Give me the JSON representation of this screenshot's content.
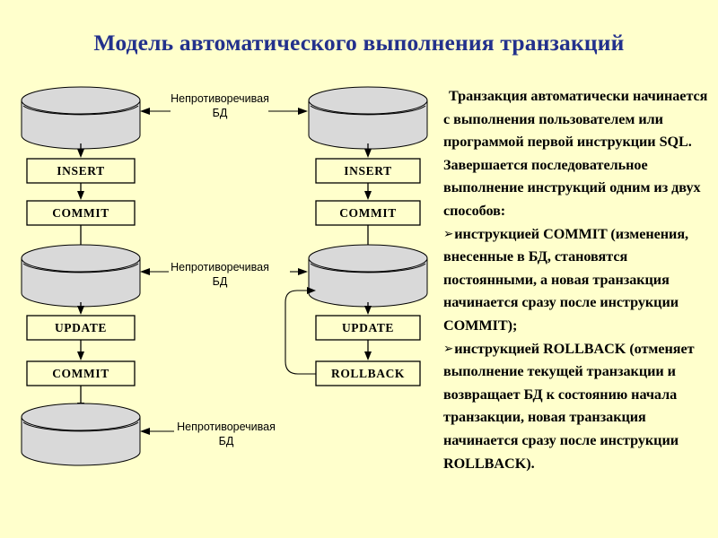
{
  "slide": {
    "title": "Модель автоматического выполнения транзакций",
    "background_color": "#ffffcc",
    "title_color": "#23318c",
    "cylinder_fill": "#d9d9d9"
  },
  "diagram": {
    "left_column": {
      "name": "commit-flow",
      "steps": [
        {
          "type": "database",
          "label": ""
        },
        {
          "type": "statement",
          "label": "INSERT"
        },
        {
          "type": "statement",
          "label": "COMMIT"
        },
        {
          "type": "database",
          "label": ""
        },
        {
          "type": "statement",
          "label": "UPDATE"
        },
        {
          "type": "statement",
          "label": "COMMIT"
        },
        {
          "type": "database",
          "label": ""
        }
      ]
    },
    "right_column": {
      "name": "rollback-flow",
      "steps": [
        {
          "type": "database",
          "label": ""
        },
        {
          "type": "statement",
          "label": "INSERT"
        },
        {
          "type": "statement",
          "label": "COMMIT"
        },
        {
          "type": "database",
          "label": ""
        },
        {
          "type": "statement",
          "label": "UPDATE"
        },
        {
          "type": "statement",
          "label": "ROLLBACK"
        }
      ]
    },
    "connector_labels": [
      {
        "line1": "Непротиворечивая",
        "line2": "БД"
      },
      {
        "line1": "Непротиворечивая",
        "line2": "БД"
      },
      {
        "line1": "Непротиворечивая",
        "line2": "БД"
      }
    ]
  },
  "panel": {
    "intro": "Транзакция автоматически начинается с выполнения пользователем или программой первой инструкции SQL. Завершается последовательное выполнение инструкций одним из двух способов:",
    "bullet_glyph": "➢",
    "bullets": [
      {
        "lead": "инструкцией ",
        "keyword": "COMMIT",
        "rest": " (изменения, внесенные в БД, становятся постоянными, а новая транзакция начинается сразу после инструкции COMMIT);"
      },
      {
        "lead": "инструкцией ",
        "keyword": "ROLLBACK",
        "rest": " (отменяет выполнение текущей транзакции и возвращает БД к состоянию начала транзакции, новая транзакция начинается сразу после инструкции ROLLBACK)."
      }
    ]
  }
}
